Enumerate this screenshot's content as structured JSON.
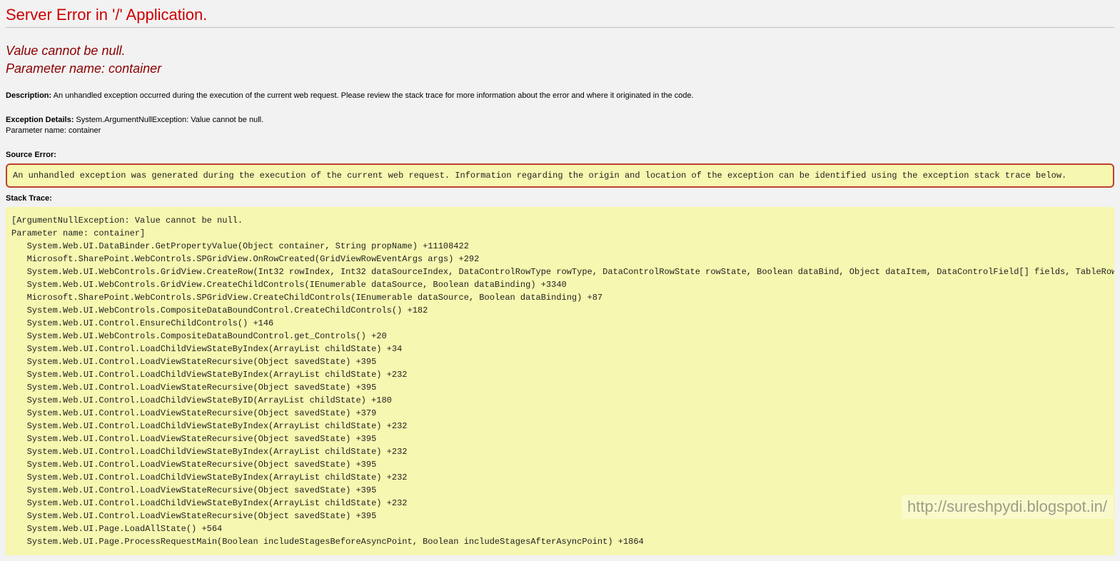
{
  "title": "Server Error in '/' Application.",
  "subtitle_line1": "Value cannot be null.",
  "subtitle_line2": "Parameter name: container",
  "description": {
    "label": "Description:",
    "text": "An unhandled exception occurred during the execution of the current web request. Please review the stack trace for more information about the error and where it originated in the code."
  },
  "exception_details": {
    "label": "Exception Details:",
    "text_line1": "System.ArgumentNullException: Value cannot be null.",
    "text_line2": "Parameter name: container"
  },
  "source_error": {
    "label": "Source Error:",
    "box_text": "An unhandled exception was generated during the execution of the current web request. Information regarding the origin and location of the exception can be identified using the exception stack trace below."
  },
  "stack_trace": {
    "label": "Stack Trace:",
    "text": "[ArgumentNullException: Value cannot be null.\nParameter name: container]\n   System.Web.UI.DataBinder.GetPropertyValue(Object container, String propName) +11108422\n   Microsoft.SharePoint.WebControls.SPGridView.OnRowCreated(GridViewRowEventArgs args) +292\n   System.Web.UI.WebControls.GridView.CreateRow(Int32 rowIndex, Int32 dataSourceIndex, DataControlRowType rowType, DataControlRowState rowState, Boolean dataBind, Object dataItem, DataControlField[] fields, TableRowCollecti\n   System.Web.UI.WebControls.GridView.CreateChildControls(IEnumerable dataSource, Boolean dataBinding) +3340\n   Microsoft.SharePoint.WebControls.SPGridView.CreateChildControls(IEnumerable dataSource, Boolean dataBinding) +87\n   System.Web.UI.WebControls.CompositeDataBoundControl.CreateChildControls() +182\n   System.Web.UI.Control.EnsureChildControls() +146\n   System.Web.UI.WebControls.CompositeDataBoundControl.get_Controls() +20\n   System.Web.UI.Control.LoadChildViewStateByIndex(ArrayList childState) +34\n   System.Web.UI.Control.LoadViewStateRecursive(Object savedState) +395\n   System.Web.UI.Control.LoadChildViewStateByIndex(ArrayList childState) +232\n   System.Web.UI.Control.LoadViewStateRecursive(Object savedState) +395\n   System.Web.UI.Control.LoadChildViewStateByID(ArrayList childState) +180\n   System.Web.UI.Control.LoadViewStateRecursive(Object savedState) +379\n   System.Web.UI.Control.LoadChildViewStateByIndex(ArrayList childState) +232\n   System.Web.UI.Control.LoadViewStateRecursive(Object savedState) +395\n   System.Web.UI.Control.LoadChildViewStateByIndex(ArrayList childState) +232\n   System.Web.UI.Control.LoadViewStateRecursive(Object savedState) +395\n   System.Web.UI.Control.LoadChildViewStateByIndex(ArrayList childState) +232\n   System.Web.UI.Control.LoadViewStateRecursive(Object savedState) +395\n   System.Web.UI.Control.LoadChildViewStateByIndex(ArrayList childState) +232\n   System.Web.UI.Control.LoadViewStateRecursive(Object savedState) +395\n   System.Web.UI.Page.LoadAllState() +564\n   System.Web.UI.Page.ProcessRequestMain(Boolean includeStagesBeforeAsyncPoint, Boolean includeStagesAfterAsyncPoint) +1864"
  },
  "watermark": "http://sureshpydi.blogspot.in/"
}
